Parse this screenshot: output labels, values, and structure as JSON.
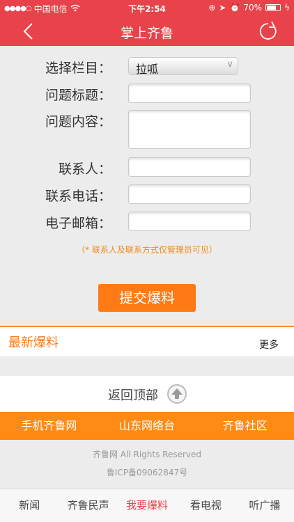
{
  "statusbar": {
    "carrier": "中国电信",
    "time": "下午2:54",
    "battery": "70%",
    "battery_level": 0.7
  },
  "navbar": {
    "title": "掌上齐鲁"
  },
  "form": {
    "labels": {
      "category": "选择栏目：",
      "title": "问题标题：",
      "content": "问题内容：",
      "contact": "联系人：",
      "phone": "联系电话：",
      "email": "电子邮箱："
    },
    "category_value": "拉呱",
    "note": "（* 联系人及联系方式仅管理员可见）",
    "submit_label": "提交爆料"
  },
  "latest": {
    "title": "最新爆料",
    "more": "更多"
  },
  "backtop": {
    "label": "返回顶部"
  },
  "links": [
    "手机齐鲁网",
    "山东网络台",
    "齐鲁社区"
  ],
  "footer": {
    "copyright": "齐鲁网 All Rights Reserved",
    "icp": "鲁ICP备09062847号"
  },
  "tabs": [
    "新闻",
    "齐鲁民声",
    "我要爆料",
    "看电视",
    "听广播"
  ],
  "active_tab_index": 2,
  "colors": {
    "header": "#e8424a",
    "accent": "#ff7a14"
  }
}
